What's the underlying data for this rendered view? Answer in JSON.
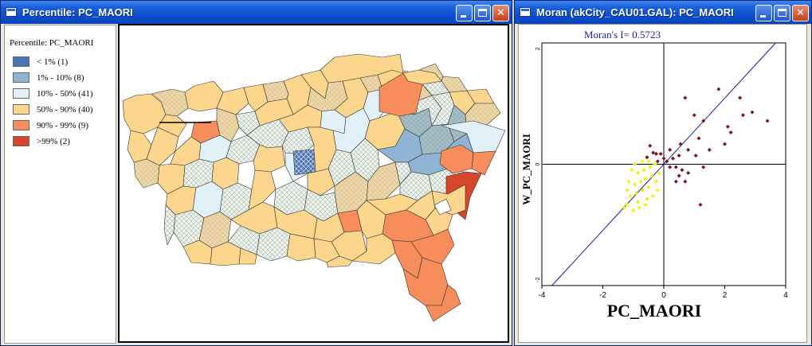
{
  "window_left": {
    "title": "Percentile: PC_MAORI",
    "legend": {
      "title": "Percentile: PC_MAORI",
      "items": [
        {
          "label": "< 1% (1)",
          "color": "#4a74b4"
        },
        {
          "label": "1% - 10% (8)",
          "color": "#8fb4d4"
        },
        {
          "label": "10% - 50% (41)",
          "color": "#e2f0f7"
        },
        {
          "label": "50% - 90% (40)",
          "color": "#fcd68c"
        },
        {
          "label": "90% - 99% (9)",
          "color": "#f68d5a"
        },
        {
          "label": ">99% (2)",
          "color": "#d6462b"
        }
      ]
    }
  },
  "window_right": {
    "title": "Moran (akCity_CAU01.GAL): PC_MAORI",
    "chart_data": {
      "type": "scatter",
      "title": "Moran's I= 0.5723",
      "xlabel": "PC_MAORI",
      "ylabel": "W_PC_MAORI",
      "xlim": [
        -4,
        4
      ],
      "ylim": [
        -2.1,
        2.1
      ],
      "x_ticks": [
        "-4",
        "-2",
        "0",
        "2",
        "4"
      ],
      "y_ticks": [
        "2",
        "0",
        "-2"
      ],
      "slope": 0.5723,
      "colors": {
        "points": "#7b1030",
        "selected": "#f2f200",
        "line": "#1c1c90"
      },
      "series": [
        {
          "name": "",
          "points": [
            [
              1.8,
              1.3
            ],
            [
              2.5,
              1.15
            ],
            [
              2.9,
              0.9
            ],
            [
              3.4,
              0.75
            ],
            [
              2.6,
              0.85
            ],
            [
              2.1,
              0.65
            ],
            [
              0.7,
              1.15
            ],
            [
              1.0,
              0.85
            ],
            [
              2.0,
              0.35
            ],
            [
              2.2,
              0.55
            ],
            [
              1.3,
              0.75
            ],
            [
              1.15,
              0.45
            ],
            [
              1.5,
              0.25
            ],
            [
              1.05,
              0.15
            ],
            [
              0.8,
              0.25
            ],
            [
              0.55,
              0.35
            ],
            [
              0.5,
              0.15
            ],
            [
              0.3,
              0.1
            ],
            [
              0.2,
              0.25
            ],
            [
              0.1,
              0.05
            ],
            [
              0.0,
              0.1
            ],
            [
              -0.1,
              0.18
            ],
            [
              -0.2,
              0.05
            ],
            [
              -0.35,
              0.2
            ],
            [
              0.4,
              -0.05
            ],
            [
              0.6,
              -0.1
            ],
            [
              0.8,
              -0.15
            ],
            [
              1.3,
              -0.05
            ],
            [
              0.2,
              -0.05
            ],
            [
              0.4,
              -0.3
            ],
            [
              0.7,
              -0.3
            ],
            [
              1.2,
              -0.7
            ],
            [
              0.5,
              -0.2
            ],
            [
              -0.55,
              0.12
            ],
            [
              -0.45,
              0.32
            ],
            [
              -0.25,
              0.18
            ]
          ]
        },
        {
          "name": "",
          "points": [
            [
              -1.2,
              -0.7
            ],
            [
              -1.0,
              -0.8
            ],
            [
              -0.85,
              -0.65
            ],
            [
              -1.1,
              -0.55
            ],
            [
              -0.9,
              -0.5
            ],
            [
              -0.7,
              -0.45
            ],
            [
              -0.5,
              -0.4
            ],
            [
              -0.95,
              -0.35
            ],
            [
              -0.75,
              -0.3
            ],
            [
              -0.6,
              -0.25
            ],
            [
              -0.4,
              -0.2
            ],
            [
              -0.85,
              -0.15
            ],
            [
              -0.65,
              -0.1
            ],
            [
              -0.45,
              -0.05
            ],
            [
              -0.3,
              0.0
            ],
            [
              -1.15,
              -0.3
            ],
            [
              -1.3,
              -0.75
            ],
            [
              -0.55,
              -0.6
            ],
            [
              -0.35,
              -0.55
            ],
            [
              -0.2,
              -0.45
            ],
            [
              -0.5,
              0.05
            ],
            [
              -0.7,
              0.05
            ],
            [
              -0.95,
              0.0
            ],
            [
              -1.05,
              -0.1
            ],
            [
              -0.25,
              -0.3
            ],
            [
              -0.15,
              -0.15
            ],
            [
              -0.8,
              -0.75
            ],
            [
              -0.6,
              -0.7
            ],
            [
              -1.2,
              -0.45
            ]
          ]
        }
      ]
    }
  }
}
